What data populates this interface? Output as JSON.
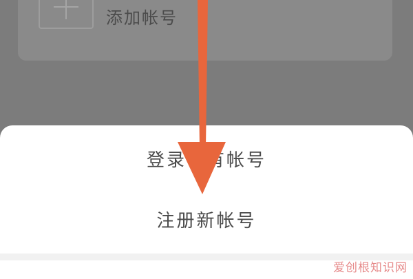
{
  "background": {
    "add_account_label": "添加帐号",
    "plus_icon": "plus-icon"
  },
  "sheet": {
    "items": [
      {
        "label": "登录已有帐号"
      },
      {
        "label": "注册新帐号"
      }
    ]
  },
  "overlay": {
    "arrow_color": "#e8663c",
    "arrow_icon": "arrow-down-icon"
  },
  "watermark": {
    "text": "爱创根知识网"
  }
}
